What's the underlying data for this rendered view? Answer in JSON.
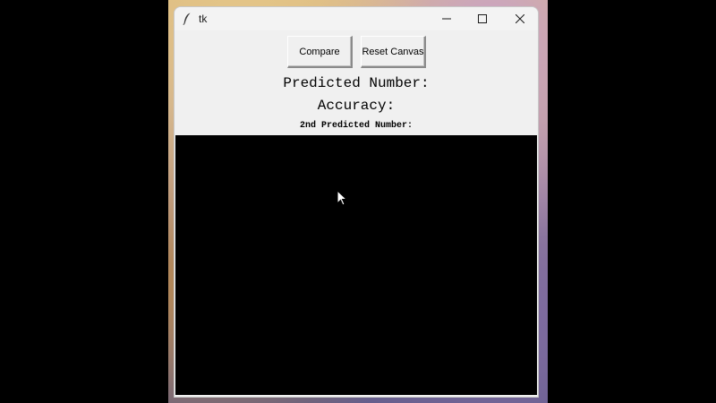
{
  "window": {
    "title": "tk",
    "controls": {
      "minimize": "minimize-icon",
      "maximize": "maximize-icon",
      "close": "close-icon"
    }
  },
  "toolbar": {
    "compare_label": "Compare",
    "reset_label": "Reset Canvas"
  },
  "results": {
    "predicted_label": "Predicted Number:",
    "accuracy_label": "Accuracy:",
    "second_predicted_label": "2nd Predicted Number:"
  },
  "canvas": {
    "background": "#000000"
  },
  "colors": {
    "window_bg": "#f0f0f0",
    "canvas_bg": "#000000"
  }
}
